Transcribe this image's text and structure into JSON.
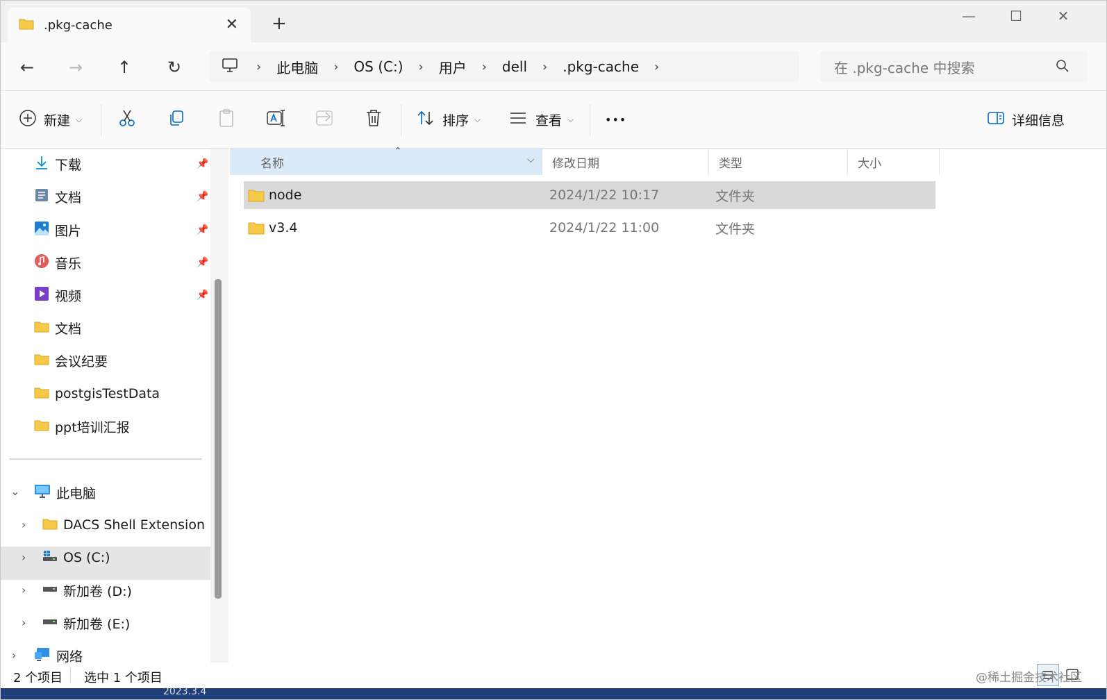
{
  "tab": {
    "title": ".pkg-cache",
    "close_glyph": "✕",
    "new_glyph": "+"
  },
  "window": {
    "min_glyph": "—",
    "max_glyph": "☐",
    "close_glyph": "✕"
  },
  "nav": {
    "back": "←",
    "forward": "→",
    "up": "↑",
    "refresh": "↻"
  },
  "breadcrumb": [
    "此电脑",
    "OS (C:)",
    "用户",
    "dell",
    ".pkg-cache"
  ],
  "breadcrumb_sep": "›",
  "search": {
    "placeholder": "在 .pkg-cache 中搜索"
  },
  "commands": {
    "new_label": "新建",
    "sort_label": "排序",
    "view_label": "查看",
    "more_label": "•••",
    "details_label": "详细信息"
  },
  "sidebar": {
    "quick_access": [
      {
        "label": "下载",
        "icon": "download-icon"
      },
      {
        "label": "文档",
        "icon": "document-icon"
      },
      {
        "label": "图片",
        "icon": "picture-icon"
      },
      {
        "label": "音乐",
        "icon": "music-icon"
      },
      {
        "label": "视频",
        "icon": "video-icon"
      },
      {
        "label": "文档",
        "icon": "folder-icon"
      },
      {
        "label": "会议纪要",
        "icon": "folder-icon"
      },
      {
        "label": "postgisTestData",
        "icon": "folder-icon"
      },
      {
        "label": "ppt培训汇报",
        "icon": "folder-icon"
      }
    ],
    "this_pc": "此电脑",
    "drives": [
      {
        "label": "DACS Shell Extension",
        "icon": "folder-icon"
      },
      {
        "label": "OS (C:)",
        "icon": "system-drive-icon"
      },
      {
        "label": "新加卷 (D:)",
        "icon": "drive-icon"
      },
      {
        "label": "新加卷 (E:)",
        "icon": "drive-icon"
      }
    ],
    "network": "网络"
  },
  "columns": {
    "name": "名称",
    "date": "修改日期",
    "type": "类型",
    "size": "大小"
  },
  "files": [
    {
      "name": "node",
      "date": "2024/1/22 10:17",
      "type": "文件夹",
      "selected": true
    },
    {
      "name": "v3.4",
      "date": "2024/1/22 11:00",
      "type": "文件夹",
      "selected": false
    }
  ],
  "status": {
    "count": "2 个项目",
    "selection": "选中 1 个项目"
  },
  "watermark": "@稀土掘金技术社区",
  "taskbar_stamp": "2023.3.4",
  "colors": {
    "accent": "#0067c0",
    "folder": "#f7c948",
    "selected_row": "#d9d9d9",
    "header_sorted": "#dbeaf8"
  }
}
